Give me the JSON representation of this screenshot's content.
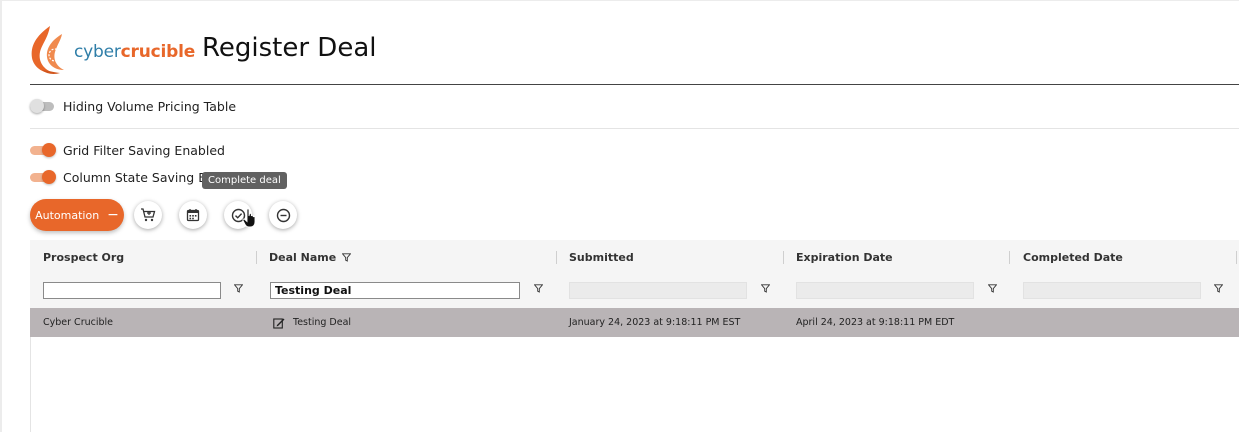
{
  "brand": {
    "word1": "cyber",
    "word2": "crucible",
    "accent": "#e8672a",
    "secondary": "#2f7ea8"
  },
  "page": {
    "title": "Register Deal"
  },
  "toggles": [
    {
      "label": "Hiding Volume Pricing Table",
      "on": false
    },
    {
      "label": "Grid Filter Saving Enabled",
      "on": true
    },
    {
      "label": "Column State Saving Enabled",
      "on": true
    }
  ],
  "tooltip": {
    "text": "Complete deal"
  },
  "toolbar": {
    "automation_label": "Automation",
    "automation_icon": "minus-icon",
    "actions": [
      {
        "name": "add-to-cart-button",
        "icon": "cart-plus-icon"
      },
      {
        "name": "calendar-button",
        "icon": "calendar-icon"
      },
      {
        "name": "complete-deal-button",
        "icon": "check-circle-icon"
      },
      {
        "name": "cancel-deal-button",
        "icon": "minus-circle-icon"
      }
    ]
  },
  "grid": {
    "columns": [
      {
        "label": "Prospect Org",
        "filter_value": "",
        "filter_enabled": true
      },
      {
        "label": "Deal Name",
        "filter_value": "Testing Deal",
        "filter_enabled": true,
        "filtered": true
      },
      {
        "label": "Submitted",
        "filter_value": "",
        "filter_enabled": false
      },
      {
        "label": "Expiration Date",
        "filter_value": "",
        "filter_enabled": false
      },
      {
        "label": "Completed Date",
        "filter_value": "",
        "filter_enabled": false
      }
    ],
    "rows": [
      {
        "prospect_org": "Cyber Crucible",
        "deal_name": "Testing Deal",
        "submitted": "January 24, 2023 at 9:18:11 PM EST",
        "expiration_date": "April 24, 2023 at 9:18:11 PM EDT",
        "completed_date": ""
      }
    ],
    "selected_row_color": "#b9b4b6"
  }
}
